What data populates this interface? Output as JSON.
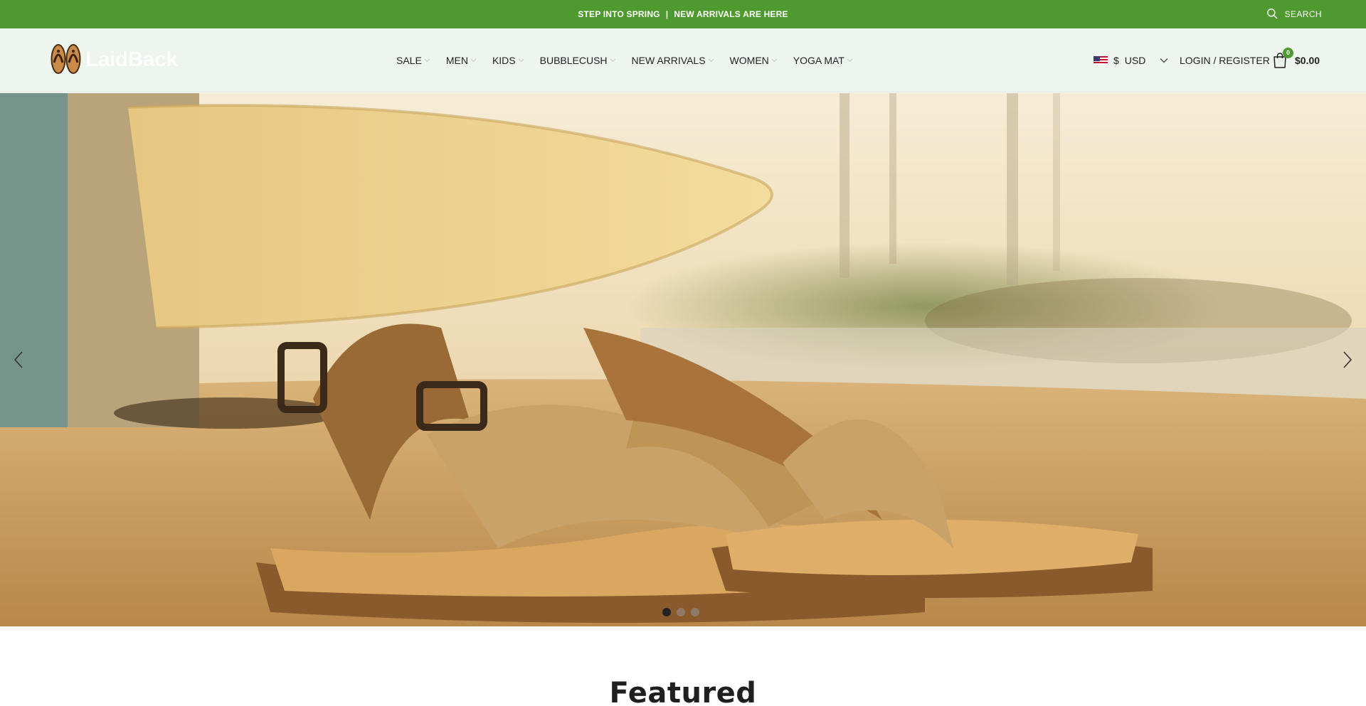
{
  "announcement": {
    "left": "STEP INTO SPRING",
    "separator": "|",
    "right": "NEW ARRIVALS ARE HERE"
  },
  "search": {
    "label": "SEARCH",
    "icon": "search-icon"
  },
  "brand": {
    "logo_text": "LaidBack",
    "logo_icon": "flip-flops-icon"
  },
  "nav": {
    "items": [
      {
        "label": "SALE"
      },
      {
        "label": "MEN"
      },
      {
        "label": "KIDS"
      },
      {
        "label": "BUBBLECUSH"
      },
      {
        "label": "NEW ARRIVALS"
      },
      {
        "label": "WOMEN"
      },
      {
        "label": "YOGA MAT"
      }
    ]
  },
  "currency": {
    "symbol": "$",
    "code": "USD",
    "flag": "us-flag-icon"
  },
  "account": {
    "login_label": "LOGIN / REGISTER"
  },
  "cart": {
    "count": "0",
    "total": "$0.00",
    "icon": "shopping-bag-icon"
  },
  "hero": {
    "slide_count": 3,
    "active_slide": 1
  },
  "featured": {
    "title": "Featured"
  },
  "colors": {
    "topbar": "#4f9a2e",
    "header_bg": "#eef5ee",
    "badge": "#4f9a2e"
  }
}
